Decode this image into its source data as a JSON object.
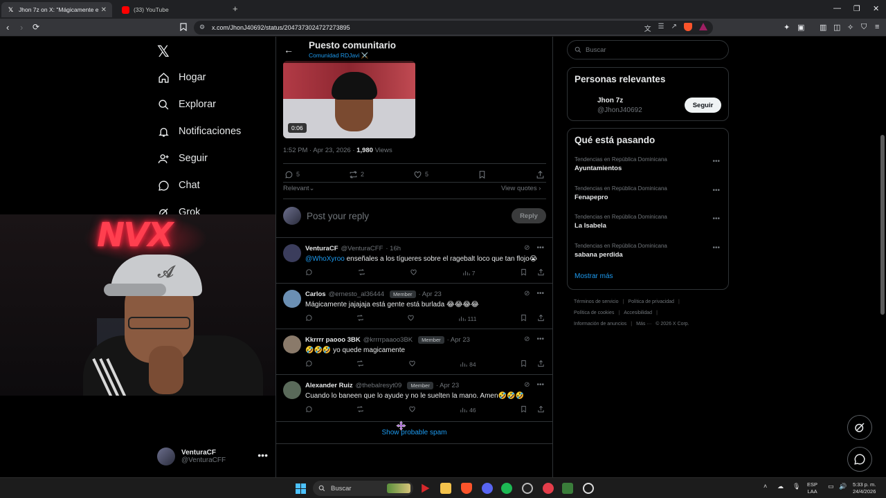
{
  "browser": {
    "tabs": [
      {
        "title": "Jhon 7z on X: \"Mágicamente en",
        "icon": "x-logo-icon",
        "active": true
      },
      {
        "title": "(33) YouTube",
        "icon": "youtube-icon",
        "active": false
      }
    ],
    "new_tab": "+",
    "url": "x.com/JhonJ40692/status/2047373024727273895"
  },
  "sidebar": {
    "items": [
      {
        "label": "Hogar",
        "icon": "home-icon"
      },
      {
        "label": "Explorar",
        "icon": "search-icon"
      },
      {
        "label": "Notificaciones",
        "icon": "bell-icon"
      },
      {
        "label": "Seguir",
        "icon": "follow-icon"
      },
      {
        "label": "Chat",
        "icon": "chat-icon"
      },
      {
        "label": "Grok",
        "icon": "grok-icon"
      }
    ],
    "account": {
      "name": "VenturaCF",
      "handle": "@VenturaCFF",
      "more": "•••"
    }
  },
  "webcam": {
    "sign": "NVX"
  },
  "header": {
    "title": "Puesto comunitario",
    "subtitle": "Comunidad RDJavi ⚔️",
    "back": "←"
  },
  "post": {
    "video_duration": "0:06",
    "time": "1:52 PM · Apr 23, 2026 · ",
    "views_count": "1,980",
    "views_label": " Views",
    "replies": "5",
    "reposts": "2",
    "likes": "5",
    "sort": "Relevant",
    "view_quotes": "View quotes"
  },
  "reply_box": {
    "placeholder": "Post your reply",
    "button": "Reply"
  },
  "replies": [
    {
      "name": "VenturaCF",
      "handle": "@VenturaCFF",
      "badge": "",
      "time": "· 16h",
      "mention": "@WhoXyroo",
      "text": " enseñales a los tígueres sobre el ragebalt loco que tan flojo😭",
      "views": "7",
      "avatar_color": "#3b3d5c"
    },
    {
      "name": "Carlos",
      "handle": "@ernesto_al36444",
      "badge": "Member",
      "time": "· Apr 23",
      "mention": "",
      "text": "Mágicamente jajajaja está gente está burlada 😂😂😂😂",
      "views": "111",
      "avatar_color": "#6b8fb3"
    },
    {
      "name": "Kkrrrr paooo 3BK",
      "handle": "@krrrrpaaoo3BK",
      "badge": "Member",
      "time": "· Apr 23",
      "mention": "",
      "text": "🤣🤣🤣 yo quede magicamente",
      "views": "84",
      "avatar_color": "#8a7a6a"
    },
    {
      "name": "Alexander Ruiz",
      "handle": "@thebalresyt09",
      "badge": "Member",
      "time": "· Apr 23",
      "mention": "",
      "text": "Cuando lo baneen que lo ayude y no le suelten la mano. Amen🤣🤣🤣",
      "views": "46",
      "avatar_color": "#5a6a5a"
    }
  ],
  "spam_link": "Show probable spam",
  "right": {
    "search_placeholder": "Buscar",
    "relevant_title": "Personas relevantes",
    "relevant_person": {
      "name": "Jhon 7z",
      "handle": "@JhonJ40692",
      "follow": "Seguir"
    },
    "trends_title": "Qué está pasando",
    "trends": [
      {
        "context": "Tendencias en República Dominicana",
        "title": "Ayuntamientos"
      },
      {
        "context": "Tendencias en República Dominicana",
        "title": "Fenapepro"
      },
      {
        "context": "Tendencias en República Dominicana",
        "title": "La Isabela"
      },
      {
        "context": "Tendencias en República Dominicana",
        "title": "sabana perdida"
      }
    ],
    "show_more": "Mostrar más",
    "footer_row1": [
      "Términos de servicio",
      "|",
      "Política de privacidad",
      "|"
    ],
    "footer_row2": [
      "Política de cookies",
      "|",
      "Accesibilidad",
      "|"
    ],
    "footer_row3": [
      "Información de anuncios",
      "|",
      "Más ···",
      "© 2026 X Corp."
    ]
  },
  "taskbar": {
    "search": "Buscar",
    "lang_top": "ESP",
    "lang_bottom": "LAA",
    "time": "5:33 p. m.",
    "date": "24/4/2026"
  },
  "colors": {
    "accent": "#1d9bf0",
    "bg": "#000000",
    "border": "#2f3336",
    "muted": "#71767b"
  }
}
